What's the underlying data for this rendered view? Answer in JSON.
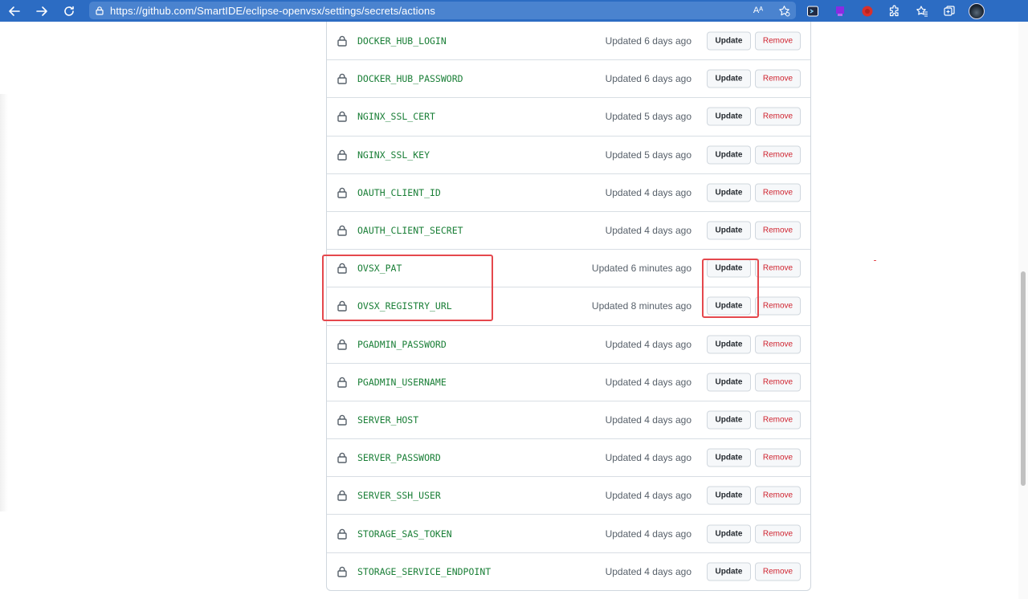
{
  "browser": {
    "url": "https://github.com/SmartIDE/eclipse-openvsx/settings/secrets/actions",
    "read_aloud_label": "Aᴬ"
  },
  "extensions": [
    {
      "name": "ext-1",
      "color": "#1f2a44"
    },
    {
      "name": "ext-2",
      "color": "#8a2be2"
    },
    {
      "name": "ext-3",
      "color": "#d9302c"
    }
  ],
  "secrets": {
    "update_label": "Update",
    "remove_label": "Remove",
    "rows": [
      {
        "name": "DOCKER_HUB_LOGIN",
        "updated": "Updated 6 days ago"
      },
      {
        "name": "DOCKER_HUB_PASSWORD",
        "updated": "Updated 6 days ago"
      },
      {
        "name": "NGINX_SSL_CERT",
        "updated": "Updated 5 days ago"
      },
      {
        "name": "NGINX_SSL_KEY",
        "updated": "Updated 5 days ago"
      },
      {
        "name": "OAUTH_CLIENT_ID",
        "updated": "Updated 4 days ago"
      },
      {
        "name": "OAUTH_CLIENT_SECRET",
        "updated": "Updated 4 days ago"
      },
      {
        "name": "OVSX_PAT",
        "updated": "Updated 6 minutes ago"
      },
      {
        "name": "OVSX_REGISTRY_URL",
        "updated": "Updated 8 minutes ago"
      },
      {
        "name": "PGADMIN_PASSWORD",
        "updated": "Updated 4 days ago"
      },
      {
        "name": "PGADMIN_USERNAME",
        "updated": "Updated 4 days ago"
      },
      {
        "name": "SERVER_HOST",
        "updated": "Updated 4 days ago"
      },
      {
        "name": "SERVER_PASSWORD",
        "updated": "Updated 4 days ago"
      },
      {
        "name": "SERVER_SSH_USER",
        "updated": "Updated 4 days ago"
      },
      {
        "name": "STORAGE_SAS_TOKEN",
        "updated": "Updated 4 days ago"
      },
      {
        "name": "STORAGE_SERVICE_ENDPOINT",
        "updated": "Updated 4 days ago"
      }
    ]
  },
  "colors": {
    "secret_name": "#1a7f37",
    "remove_text": "#cf222e",
    "highlight": "#e5484d",
    "toolbar": "#2c6cc3"
  }
}
